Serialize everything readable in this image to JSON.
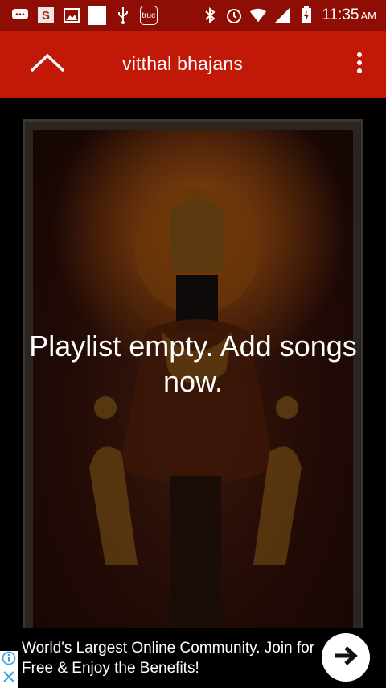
{
  "status_bar": {
    "time": "11:35",
    "ampm": "AM",
    "left_icons": [
      "message-icon",
      "s-app-icon",
      "gallery-icon",
      "blank-notification-icon",
      "usb-icon",
      "true-app-icon"
    ],
    "right_icons": [
      "bluetooth-icon",
      "alarm-icon",
      "wifi-icon",
      "signal-icon",
      "battery-icon"
    ],
    "true_label": "true",
    "s_label": "S"
  },
  "app_bar": {
    "title": "vitthal bhajans",
    "up_icon": "chevron-up-icon",
    "menu_icon": "overflow-menu-icon"
  },
  "content": {
    "empty_message": "Playlist empty. Add songs now."
  },
  "ad": {
    "text": "World's Largest Online Community. Join for Free & Enjoy the Benefits!",
    "info_icon": "info-icon",
    "close_icon": "close-icon",
    "go_icon": "arrow-right-icon"
  },
  "colors": {
    "status_bar": "#8e0d05",
    "app_bar": "#c21807",
    "background": "#000000"
  }
}
